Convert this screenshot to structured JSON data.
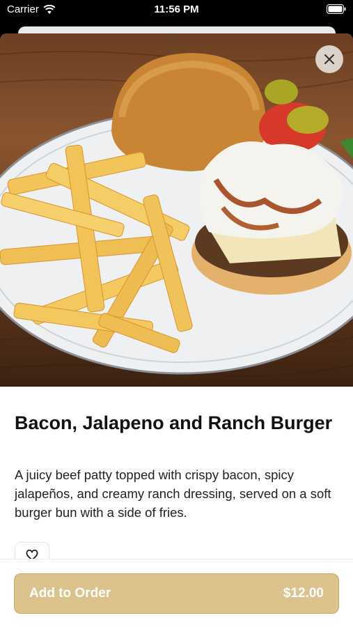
{
  "status_bar": {
    "carrier": "Carrier",
    "time": "11:56 PM"
  },
  "item": {
    "name": "Bacon, Jalapeno and Ranch Burger",
    "description": "A juicy beef patty topped with crispy bacon, spicy jalapeños, and creamy ranch dressing, served on a soft burger bun with a side of fries.",
    "price": "$12.00"
  },
  "actions": {
    "add_to_order_label": "Add to Order"
  },
  "colors": {
    "accent": "#dcc28d",
    "accent_border": "#c9a85f"
  },
  "icons": {
    "close": "close-icon",
    "favorite": "heart-icon",
    "wifi": "wifi-icon",
    "battery": "battery-icon"
  }
}
